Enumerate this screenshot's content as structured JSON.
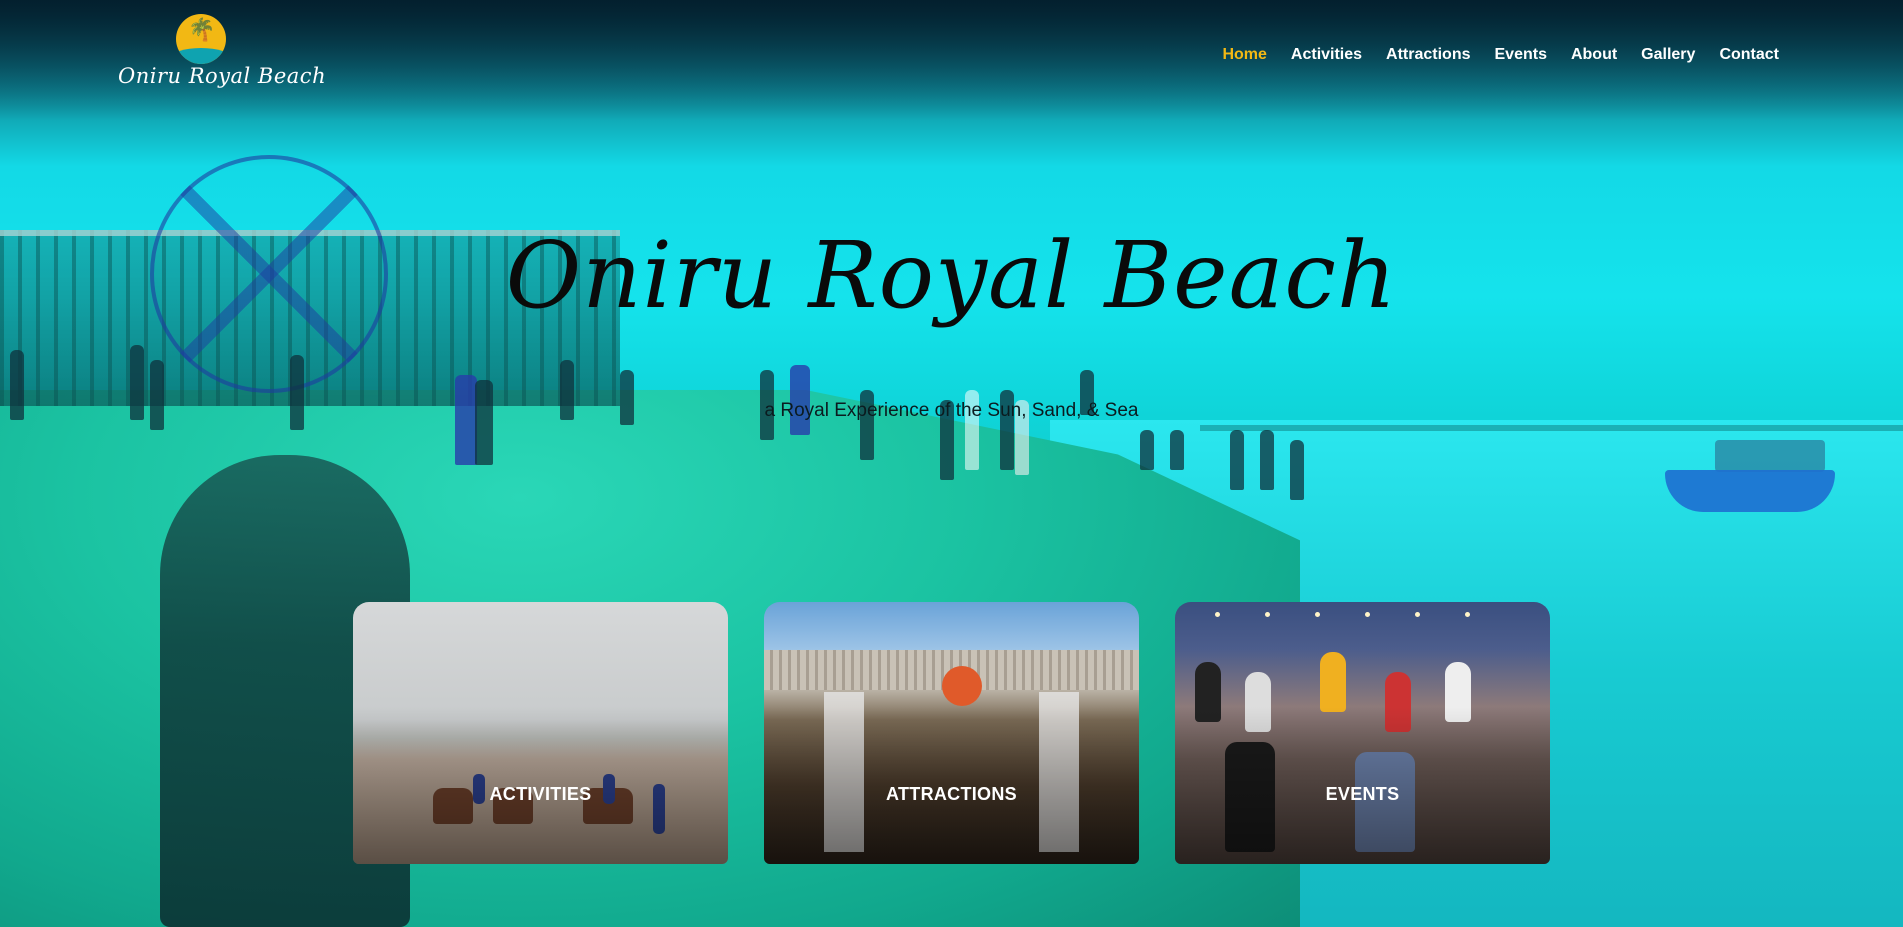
{
  "brand": {
    "logo_text": "Oniru Royal Beach"
  },
  "nav": {
    "items": [
      {
        "label": "Home",
        "active": true
      },
      {
        "label": "Activities",
        "active": false
      },
      {
        "label": "Attractions",
        "active": false
      },
      {
        "label": "Events",
        "active": false
      },
      {
        "label": "About",
        "active": false
      },
      {
        "label": "Gallery",
        "active": false
      },
      {
        "label": "Contact",
        "active": false
      }
    ]
  },
  "hero": {
    "title": "Oniru Royal Beach",
    "subtitle": "a Royal Experience of the Sun, Sand, & Sea"
  },
  "cards": [
    {
      "label": "ACTIVITIES"
    },
    {
      "label": "ATTRACTIONS"
    },
    {
      "label": "EVENTS"
    }
  ],
  "colors": {
    "accent": "#f2b814",
    "nav_text": "#ffffff",
    "overlay": "#15e3ec"
  }
}
